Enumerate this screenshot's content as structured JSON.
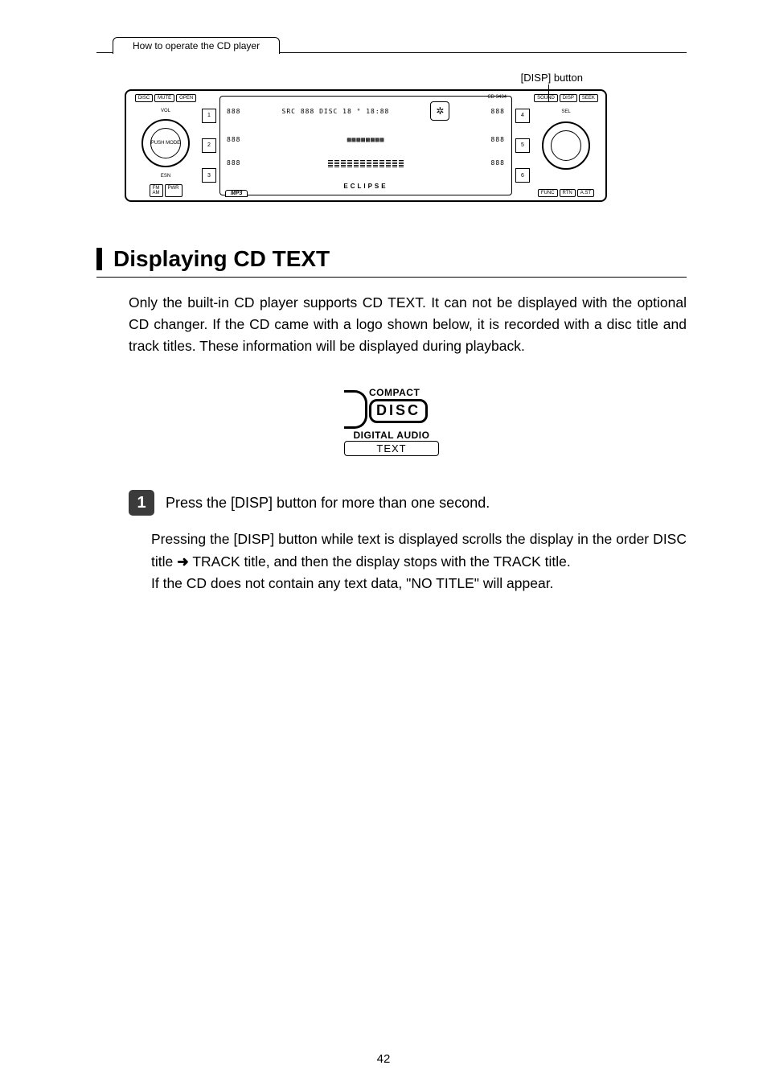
{
  "breadcrumb": "How to operate the CD player",
  "callout": "[DISP] button",
  "stereo": {
    "top_left_buttons": [
      "DISC",
      "MUTE",
      "OPEN"
    ],
    "vol_label": "VOL",
    "left_knob": "PUSH MODE",
    "esn_label": "ESN",
    "bottom_left_buttons_a": "FM\nAM",
    "bottom_left_buttons_b": "PWR",
    "preset_left": [
      "1",
      "2",
      "3"
    ],
    "preset_right": [
      "4",
      "5",
      "6"
    ],
    "model": "CD 3434",
    "mp3": "MP3",
    "brand": "ECLIPSE",
    "disp_seg_left": [
      "888",
      "888",
      "888"
    ],
    "disp_top": "SRC 888 DISC 18 ° 18:88",
    "disp_seg_right": [
      "888",
      "888",
      "888"
    ],
    "top_right_buttons": [
      "SOUND",
      "DISP",
      "SEEK"
    ],
    "sel_label": "SEL",
    "bottom_right_buttons": [
      "FUNC",
      "RTN",
      "A.ST"
    ]
  },
  "section_title": "Displaying CD TEXT",
  "intro": "Only the built-in CD player supports CD TEXT. It can not be displayed with the optional CD changer. If the CD came with a logo shown below, it is recorded with a disc title and track titles. These information will be displayed during playback.",
  "cd_logo": {
    "compact": "COMPACT",
    "disc": "DISC",
    "digital": "DIGITAL AUDIO",
    "text": "TEXT"
  },
  "step_number": "1",
  "step_heading": "Press the [DISP] button for more than one second.",
  "step_body_1": "Pressing the [DISP] button while text is displayed scrolls the display in the order DISC title ",
  "step_arrow": "➜",
  "step_body_2": " TRACK title, and then the display stops with the TRACK title.",
  "step_body_3": "If the CD does not contain any text data, \"NO TITLE\" will appear.",
  "page_number": "42"
}
